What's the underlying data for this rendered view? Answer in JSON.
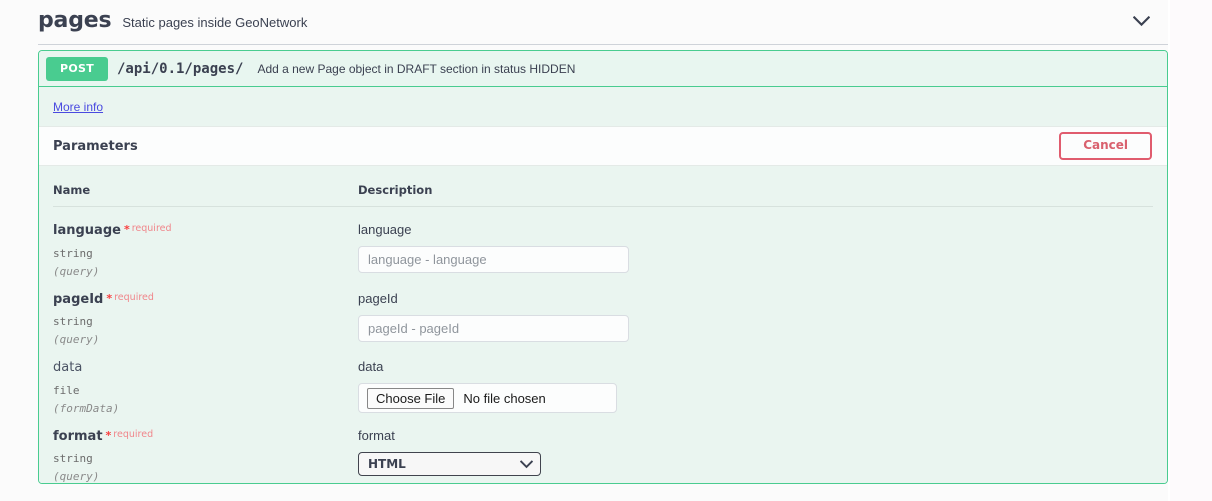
{
  "tag": {
    "name": "pages",
    "description": "Static pages inside GeoNetwork",
    "toggle_icon": "chevron-down-icon"
  },
  "operation": {
    "method": "POST",
    "path": "/api/0.1/pages/",
    "summary": "Add a new Page object in DRAFT section in status HIDDEN",
    "more_info_label": "More info",
    "method_color": "#49cc90",
    "border_color": "#49cc90",
    "body_background": "#eaf5f0"
  },
  "parameters_section": {
    "title": "Parameters",
    "cancel_label": "Cancel",
    "cancel_color": "#e05c6e",
    "columns": {
      "name": "Name",
      "description": "Description"
    },
    "required_marker": "*",
    "required_word": "required",
    "rows": [
      {
        "name": "language",
        "required": true,
        "type": "string",
        "in": "(query)",
        "desc_label": "language",
        "control": "text",
        "placeholder": "language - language",
        "value": ""
      },
      {
        "name": "pageId",
        "required": true,
        "type": "string",
        "in": "(query)",
        "desc_label": "pageId",
        "control": "text",
        "placeholder": "pageId - pageId",
        "value": ""
      },
      {
        "name": "data",
        "required": false,
        "type": "file",
        "in": "(formData)",
        "desc_label": "data",
        "control": "file",
        "file_button_label": "Choose File",
        "file_status": "No file chosen"
      },
      {
        "name": "format",
        "required": true,
        "type": "string",
        "in": "(query)",
        "desc_label": "format",
        "control": "select",
        "selected": "HTML",
        "options": [
          "HTML"
        ]
      }
    ]
  }
}
